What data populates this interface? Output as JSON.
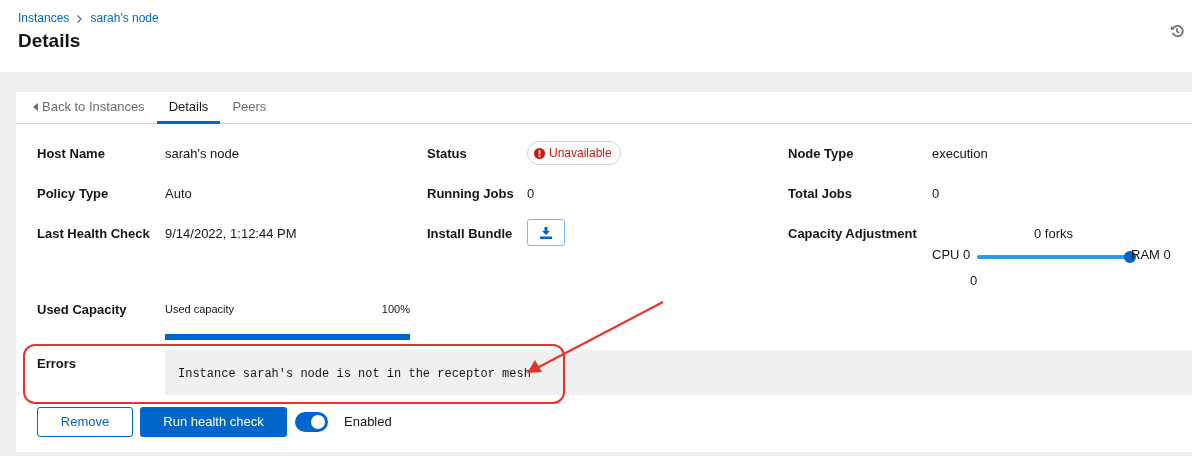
{
  "breadcrumb": [
    {
      "label": "Instances"
    },
    {
      "label": "sarah's node"
    }
  ],
  "title": "Details",
  "tabs": [
    {
      "label": "Back to Instances",
      "kind": "back",
      "selected": false
    },
    {
      "label": "Details",
      "kind": "tab",
      "selected": true
    },
    {
      "label": "Peers",
      "kind": "tab",
      "selected": false
    }
  ],
  "fields": [
    {
      "label": "Host Name",
      "kind": "text",
      "value": "sarah's node"
    },
    {
      "label": "Status",
      "kind": "status",
      "value": "Unavailable"
    },
    {
      "label": "Node Type",
      "kind": "text",
      "value": "execution"
    },
    {
      "label": "Policy Type",
      "kind": "text",
      "value": "Auto"
    },
    {
      "label": "Running Jobs",
      "kind": "text",
      "value": "0"
    },
    {
      "label": "Total Jobs",
      "kind": "text",
      "value": "0"
    },
    {
      "label": "Last Health Check",
      "kind": "text",
      "value": "9/14/2022, 1:12:44 PM"
    },
    {
      "label": "Install Bundle",
      "kind": "download"
    },
    {
      "label": "Capacity Adjustment",
      "kind": "slider",
      "top": "0 forks",
      "left": "CPU 0",
      "right": "RAM 0",
      "below": "0",
      "level": 1
    }
  ],
  "used_capacity": {
    "label": "Used Capacity",
    "bar_label": "Used capacity",
    "reading": "100%",
    "level": 1
  },
  "errors": {
    "label": "Errors",
    "message": "Instance sarah's node is not in the receptor mesh"
  },
  "buttons": [
    {
      "label": "Remove",
      "kind": "secondary"
    },
    {
      "label": "Run health check",
      "kind": "primary"
    }
  ],
  "toggle": {
    "label": "Enabled",
    "on": true
  }
}
